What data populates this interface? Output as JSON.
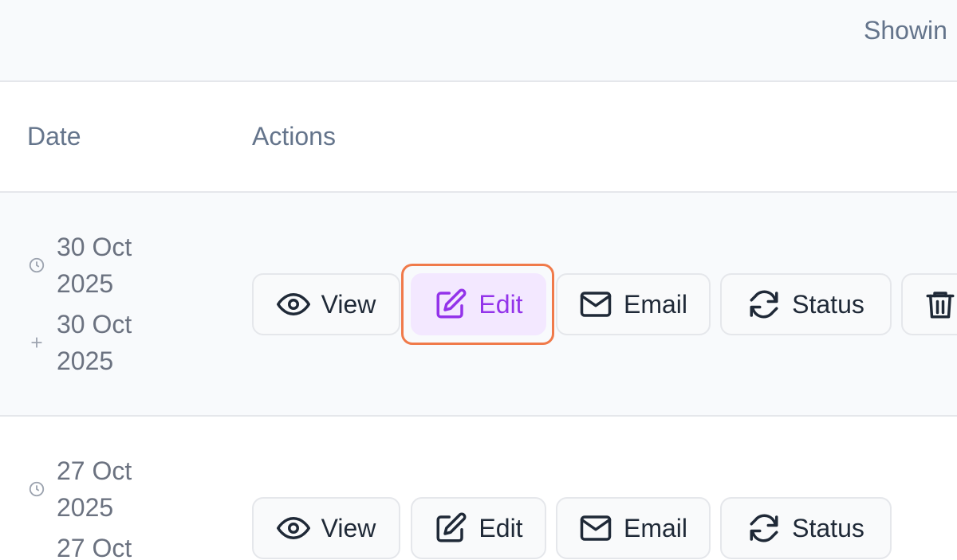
{
  "header": {
    "showing_text": "Showin"
  },
  "table": {
    "columns": {
      "date": "Date",
      "actions": "Actions"
    },
    "rows": [
      {
        "created": [
          "30 Oct",
          "2025"
        ],
        "updated": [
          "30 Oct",
          "2025"
        ],
        "actions": {
          "view": "View",
          "edit": "Edit",
          "email": "Email",
          "status": "Status"
        }
      },
      {
        "created": [
          "27 Oct",
          "2025"
        ],
        "updated": [
          "27 Oct"
        ],
        "actions": {
          "view": "View",
          "edit": "Edit",
          "email": "Email",
          "status": "Status"
        }
      }
    ]
  },
  "colors": {
    "accent": "#9333ea",
    "active_bg": "#f3e8ff",
    "highlight": "#f07a4a",
    "muted_text": "#64748b"
  },
  "icons": {
    "view": "eye-icon",
    "edit": "edit-icon",
    "email": "mail-icon",
    "status": "refresh-icon",
    "delete": "trash-icon",
    "created": "clock-icon",
    "updated": "plus-icon"
  }
}
